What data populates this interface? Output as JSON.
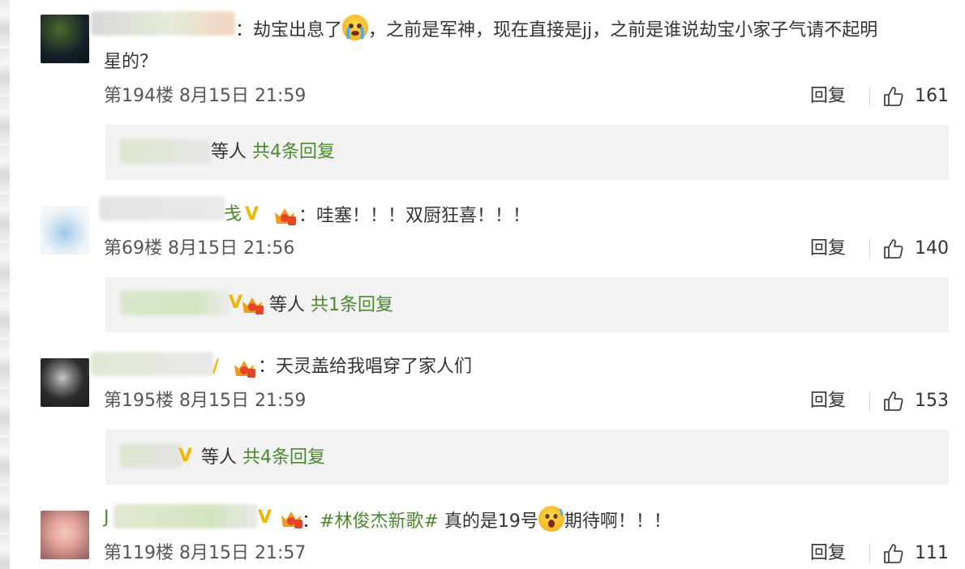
{
  "comments": [
    {
      "text_segments": [
        "：劫宝出息了",
        "，之前是军神，现在直接是jj，之前是谁说劫宝小家子气请不起明"
      ],
      "text_line2": "星的？",
      "name_suffix": "",
      "floor": "第194楼",
      "date": "8月15日",
      "time": "21:59",
      "reply_label": "回复",
      "likes": "161",
      "replies_who": "等人",
      "replies_count": "共4条回复",
      "emoji": "crying-emoji"
    },
    {
      "name_suffix": "戋",
      "text": "：哇塞！！！双厨狂喜！！！",
      "floor": "第69楼",
      "date": "8月15日",
      "time": "21:56",
      "reply_label": "回复",
      "likes": "140",
      "replies_who": "等人",
      "replies_count": "共1条回复"
    },
    {
      "text": "：天灵盖给我唱穿了家人们",
      "floor": "第195楼",
      "date": "8月15日",
      "time": "21:59",
      "reply_label": "回复",
      "likes": "153",
      "replies_who": "等人",
      "replies_count": "共4条回复"
    },
    {
      "name_prefix": "J",
      "hashtag": "#林俊杰新歌#",
      "text_a": "真的是19号",
      "text_b": "期待啊！！！",
      "colon": "：",
      "floor": "第119楼",
      "date": "8月15日",
      "time": "21:57",
      "reply_label": "回复",
      "likes": "111",
      "emoji": "shocked-emoji"
    }
  ],
  "colors": {
    "link_green": "#4a8a2c",
    "verified_gold": "#f4b400",
    "reply_box_bg": "#f2f2f2"
  },
  "icons": [
    "like-icon",
    "verified-icon",
    "crown-badge-icon"
  ]
}
